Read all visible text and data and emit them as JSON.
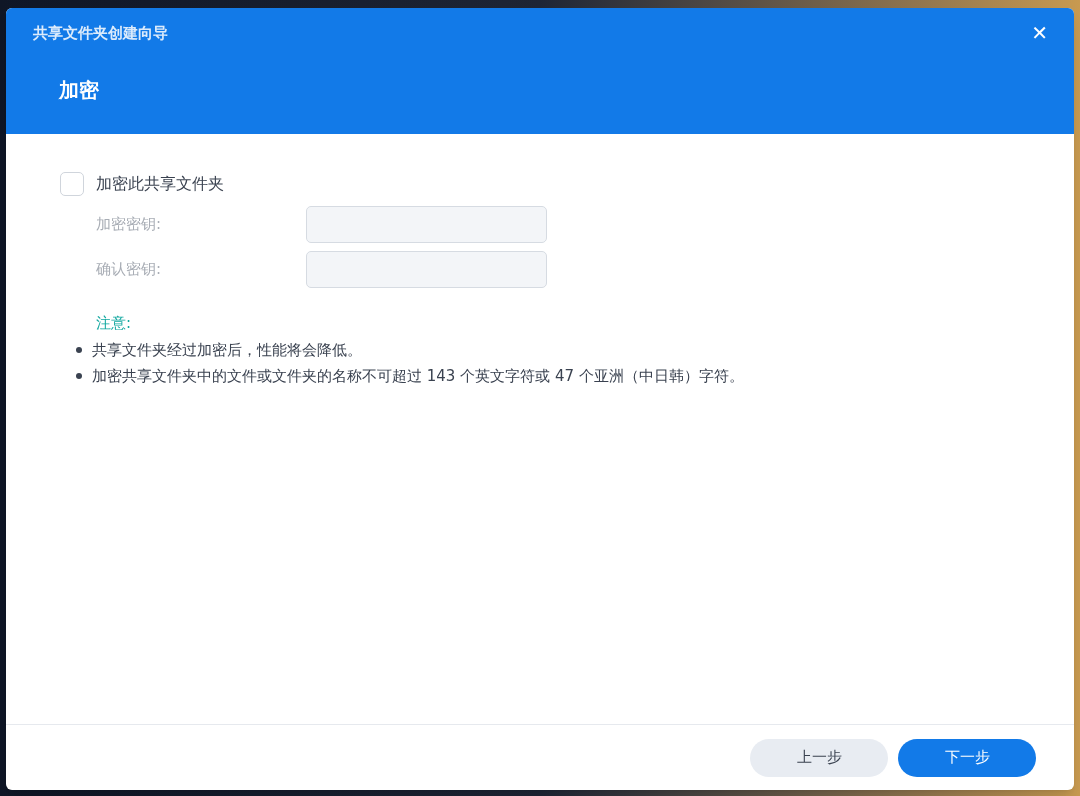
{
  "window": {
    "title": "共享文件夹创建向导",
    "close": "✕"
  },
  "step_title": "加密",
  "encrypt_option": {
    "label": "加密此共享文件夹",
    "checked": false
  },
  "fields": [
    {
      "label": "加密密钥:",
      "disabled": true
    },
    {
      "label": "确认密钥:",
      "disabled": true
    }
  ],
  "note": {
    "title": "注意:",
    "items": [
      "共享文件夹经过加密后，性能将会降低。",
      "加密共享文件夹中的文件或文件夹的名称不可超过 143 个英文字符或 47 个亚洲（中日韩）字符。"
    ]
  },
  "buttons": [
    {
      "label": "上一步",
      "kind": "secondary"
    },
    {
      "label": "下一步",
      "kind": "primary"
    }
  ]
}
